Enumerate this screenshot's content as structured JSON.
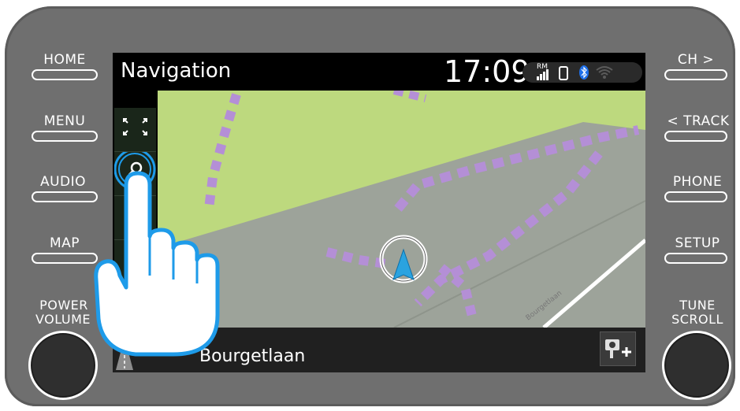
{
  "hardware_buttons": {
    "left": [
      "HOME",
      "MENU",
      "AUDIO",
      "MAP"
    ],
    "right": [
      "CH >",
      "< TRACK",
      "PHONE",
      "SETUP"
    ],
    "left_knob_line1": "POWER",
    "left_knob_line2": "VOLUME",
    "right_knob_line1": "TUNE",
    "right_knob_line2": "SCROLL"
  },
  "screen": {
    "title": "Navigation",
    "clock": "17:09",
    "status": {
      "radio_label": "RM"
    },
    "street_name": "Bourgetlaan",
    "map_road_label": "Bourgetlaan",
    "colors": {
      "map_green": "#bdd97e",
      "map_gray": "#9da39a",
      "route_purple": "#b48fd6",
      "accent_blue": "#1e9be9",
      "cursor_blue": "#2aa3e0"
    }
  },
  "icons": {
    "fullscreen": "fullscreen-icon",
    "search": "search-icon",
    "position": "position-arrow-icon",
    "lane": "lane-road-icon",
    "add_speedcam": "add-camera-icon",
    "bluetooth": "bluetooth-icon",
    "wifi": "wifi-icon",
    "phone": "phone-icon",
    "signal": "signal-icon",
    "hand": "hand-pointer-icon"
  }
}
